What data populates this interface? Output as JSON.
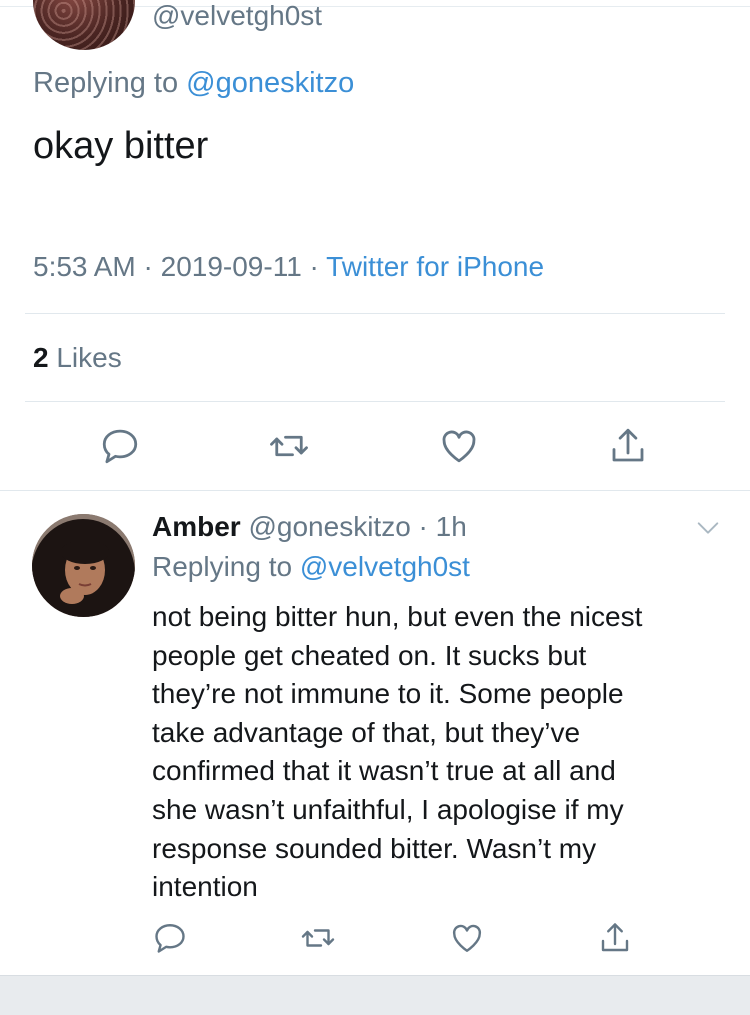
{
  "top_tweet": {
    "handle": "@velvetgh0st",
    "replying_label": "Replying to ",
    "replying_to": "@goneskitzo",
    "text": "okay bitter",
    "time": "5:53 AM",
    "date": "2019-09-11",
    "sep": " · ",
    "source": "Twitter for iPhone",
    "likes_count": "2",
    "likes_label": " Likes"
  },
  "reply_tweet": {
    "name": "Amber",
    "handle": "@goneskitzo",
    "age": "1h",
    "replying_label": "Replying to ",
    "replying_to": "@velvetgh0st",
    "text": "not being bitter hun, but even the nicest\npeople get cheated on. It sucks but\nthey’re not immune to it. Some people\ntake advantage of that, but they’ve\nconfirmed that it wasn’t true at all and\nshe wasn’t unfaithful, I apologise if my\nresponse sounded bitter. Wasn’t my\nintention"
  },
  "icons": [
    "reply-icon",
    "retweet-icon",
    "like-icon",
    "share-icon",
    "chevron-down-icon"
  ],
  "colors": {
    "link": "#3b8fd6",
    "muted": "#657786",
    "text": "#14171a",
    "icon": "#657786"
  }
}
